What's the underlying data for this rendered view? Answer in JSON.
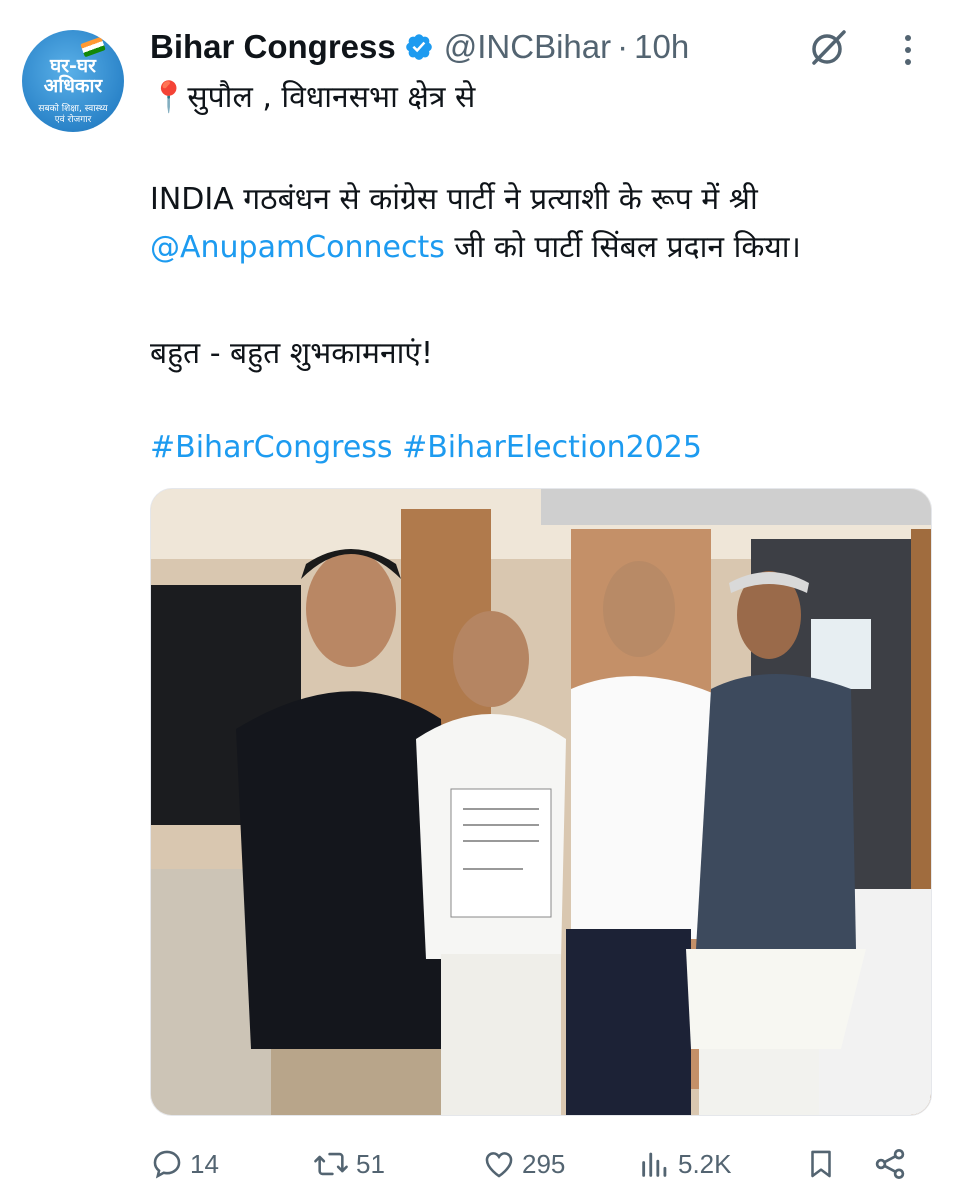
{
  "author": {
    "avatar_line1": "घर-घर",
    "avatar_line2": "अधिकार",
    "avatar_tagline": "सबको शिक्षा, स्वास्थ्य एवं रोजगार",
    "name": "Bihar Congress",
    "handle": "@INCBihar",
    "separator": "·",
    "time": "10h"
  },
  "tweet": {
    "line1": "📍सुपौल , विधानसभा क्षेत्र से",
    "line2": " INDIA गठबंधन से कांग्रेस पार्टी ने प्रत्याशी के रूप में  श्री",
    "mention": "@AnupamConnects",
    "line3_rest": "  जी को पार्टी सिंबल प्रदान किया।",
    "line4": "बहुत - बहुत शुभकामनाएं!",
    "hashtag1": "#BiharCongress",
    "hashtag2": "#BiharElection2025"
  },
  "stats": {
    "replies": "14",
    "reposts": "51",
    "likes": "295",
    "views": "5.2K"
  },
  "colors": {
    "link": "#1d9bf0",
    "muted": "#536471",
    "verified": "#1d9bf0"
  },
  "icons": [
    "verified-badge-icon",
    "grok-icon",
    "more-icon",
    "reply-icon",
    "repost-icon",
    "like-icon",
    "views-icon",
    "bookmark-icon",
    "share-icon"
  ]
}
